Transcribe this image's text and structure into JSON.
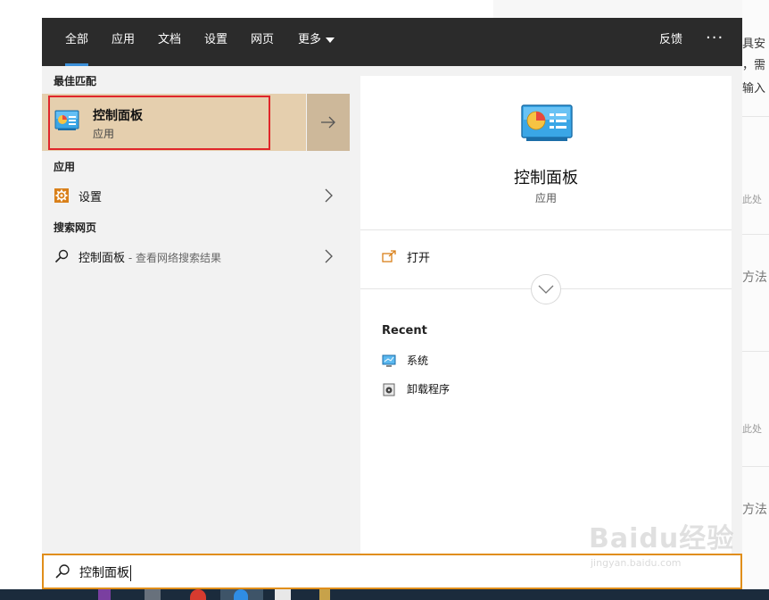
{
  "tabs": [
    {
      "label": "全部",
      "active": true
    },
    {
      "label": "应用",
      "active": false
    },
    {
      "label": "文档",
      "active": false
    },
    {
      "label": "设置",
      "active": false
    },
    {
      "label": "网页",
      "active": false
    },
    {
      "label": "更多",
      "active": false
    }
  ],
  "topbar": {
    "feedback": "反馈",
    "more_options": "···"
  },
  "left": {
    "best_match_heading": "最佳匹配",
    "best_match": {
      "title": "控制面板",
      "subtitle": "应用",
      "icon": "control-panel-icon"
    },
    "apps_heading": "应用",
    "apps": [
      {
        "label": "设置",
        "icon": "gear-icon"
      }
    ],
    "web_heading": "搜索网页",
    "web": [
      {
        "label": "控制面板",
        "hint": " - 查看网络搜索结果",
        "icon": "search-icon"
      }
    ]
  },
  "detail": {
    "title": "控制面板",
    "subtitle": "应用",
    "open_label": "打开",
    "recent_heading": "Recent",
    "recent": [
      {
        "label": "系统",
        "icon": "monitor-icon"
      },
      {
        "label": "卸载程序",
        "icon": "uninstall-icon"
      }
    ]
  },
  "search": {
    "value": "控制面板"
  },
  "background_page": {
    "snippets": [
      "具安",
      "，需",
      "输入",
      "此处",
      "方法",
      "此处",
      "方法"
    ]
  },
  "watermark": {
    "text": "Baidu经验",
    "url": "jingyan.baidu.com"
  },
  "colors": {
    "accent_search": "#e08e1a",
    "selection": "#e5cfae",
    "highlight_box": "#e0262a",
    "tab_underline": "#3b8fd8"
  }
}
